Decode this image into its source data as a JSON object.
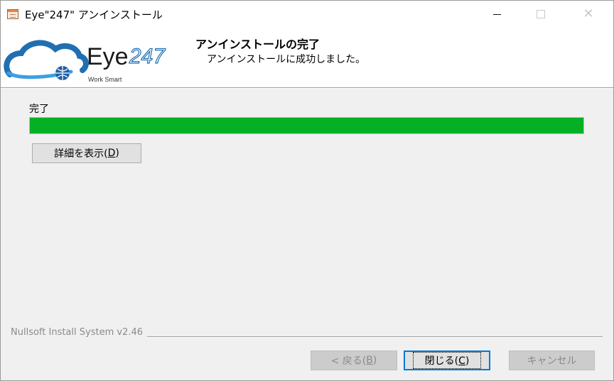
{
  "window": {
    "title": "Eye\"247\" アンインストール"
  },
  "header": {
    "logo_text": "Eye",
    "logo_number": "247",
    "logo_tagline": "Work Smart",
    "title": "アンインストールの完了",
    "subtitle": "アンインストールに成功しました。"
  },
  "main": {
    "status_label": "完了",
    "progress_percent": 100,
    "details_button_label": "詳細を表示(",
    "details_button_key": "D",
    "details_button_tail": ")"
  },
  "footer": {
    "brand_text": "Nullsoft Install System v2.46",
    "back_label": "< 戻る(",
    "back_key": "B",
    "back_tail": ")",
    "close_label": "閉じる(",
    "close_key": "C",
    "close_tail": ")",
    "cancel_label": "キャンセル"
  },
  "colors": {
    "progress": "#06b025",
    "accent_focus": "#0078d7"
  }
}
